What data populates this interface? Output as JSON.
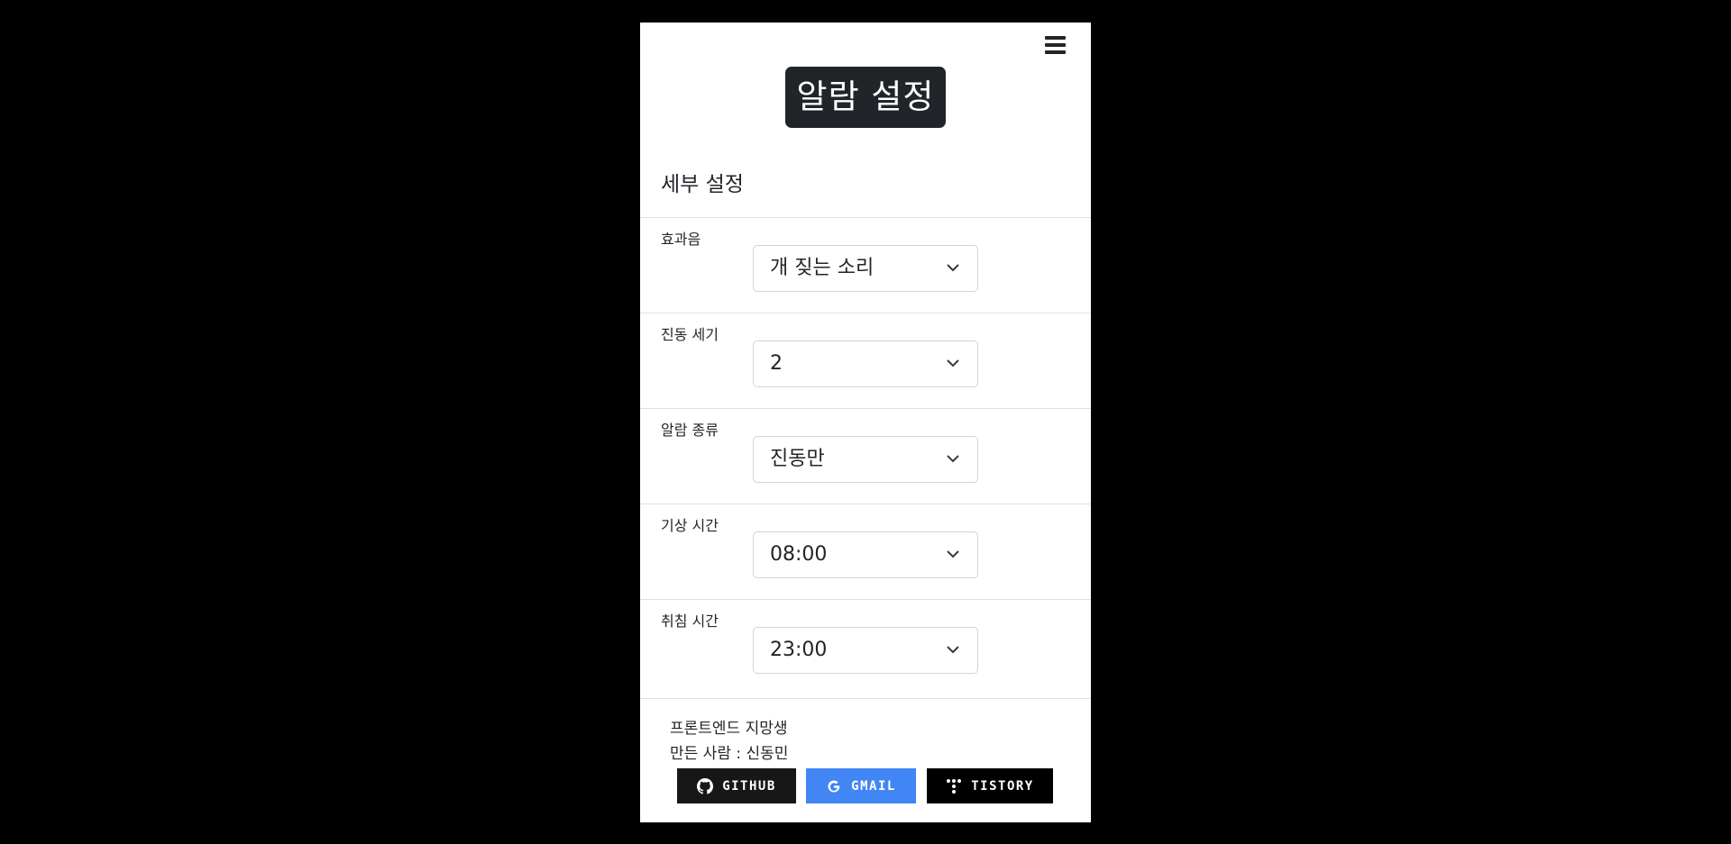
{
  "header": {
    "menu_icon": "hamburger-menu-icon",
    "title": "알람 설정"
  },
  "section": {
    "title": "세부 설정"
  },
  "settings": [
    {
      "label": "효과음",
      "value": "개 짖는 소리"
    },
    {
      "label": "진동 세기",
      "value": "2"
    },
    {
      "label": "알람 종류",
      "value": "진동만"
    },
    {
      "label": "기상 시간",
      "value": "08:00"
    },
    {
      "label": "취침 시간",
      "value": "23:00"
    }
  ],
  "footer": {
    "line1": "프론트엔드 지망생",
    "line2": "만든 사람 : 신동민",
    "badges": [
      {
        "label": "GITHUB",
        "icon": "github-icon",
        "color": "#181717"
      },
      {
        "label": "GMAIL",
        "icon": "google-icon",
        "color": "#4285F4"
      },
      {
        "label": "TISTORY",
        "icon": "tistory-icon",
        "color": "#000000"
      }
    ]
  },
  "colors": {
    "background": "#000000",
    "surface": "#ffffff",
    "dark": "#212529",
    "border": "#dee2e6"
  }
}
